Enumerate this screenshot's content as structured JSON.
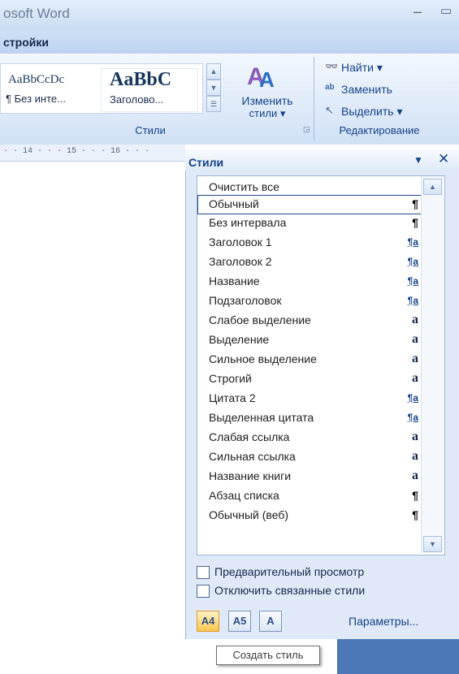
{
  "titlebar": {
    "title": "osoft Word",
    "minimize_glyph": "–",
    "restore_glyph": "▭"
  },
  "tabs": {
    "visible_tab": "стройки"
  },
  "ribbon": {
    "styles_gallery": [
      {
        "preview": "AaBbCcDc",
        "label": "¶ Без инте..."
      },
      {
        "preview": "AaBbC",
        "label": "Заголово..."
      }
    ],
    "change_styles": {
      "icon": "change-styles-icon",
      "line1": "Изменить",
      "line2": "стили ▾"
    },
    "styles_group_label": "Стили",
    "editing": {
      "find": "Найти ▾",
      "replace": "Заменить",
      "select": "Выделить ▾",
      "group_label": "Редактирование"
    }
  },
  "ruler": {
    "text": "· · 14 · · · 15 · · · 16 · · ·"
  },
  "styles_pane": {
    "title": "Стили",
    "menu_glyph": "▼",
    "close_glyph": "✕",
    "items": [
      {
        "name": "Очистить все",
        "glyph": ""
      },
      {
        "name": "Обычный",
        "glyph": "¶"
      },
      {
        "name": "Без интервала",
        "glyph": "¶"
      },
      {
        "name": "Заголовок 1",
        "glyph": "¶a"
      },
      {
        "name": "Заголовок 2",
        "glyph": "¶a"
      },
      {
        "name": "Название",
        "glyph": "¶a"
      },
      {
        "name": "Подзаголовок",
        "glyph": "¶a"
      },
      {
        "name": "Слабое выделение",
        "glyph": "a"
      },
      {
        "name": "Выделение",
        "glyph": "a"
      },
      {
        "name": "Сильное выделение",
        "glyph": "a"
      },
      {
        "name": "Строгий",
        "glyph": "a"
      },
      {
        "name": "Цитата 2",
        "glyph": "¶a"
      },
      {
        "name": "Выделенная цитата",
        "glyph": "¶a"
      },
      {
        "name": "Слабая ссылка",
        "glyph": "a"
      },
      {
        "name": "Сильная ссылка",
        "glyph": "a"
      },
      {
        "name": "Название книги",
        "glyph": "a"
      },
      {
        "name": "Абзац списка",
        "glyph": "¶"
      },
      {
        "name": "Обычный (веб)",
        "glyph": "¶"
      }
    ],
    "selected_item": "Обычный",
    "show_preview_label": "Предварительный просмотр",
    "disable_linked_label": "Отключить связанные стили",
    "buttons": {
      "new_style": "A4",
      "style_inspector": "A5",
      "manage_styles": "A"
    },
    "options_link": "Параметры..."
  },
  "tooltip": {
    "text": "Создать стиль"
  }
}
